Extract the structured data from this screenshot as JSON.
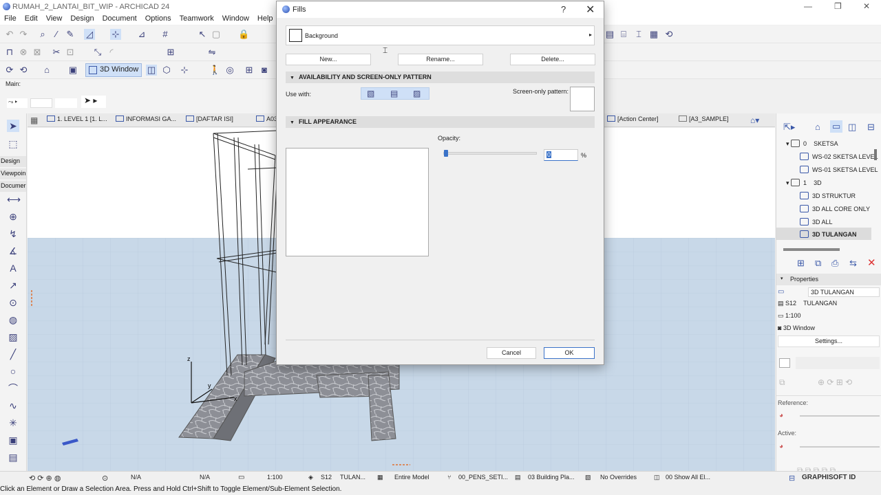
{
  "window": {
    "title": "RUMAH_2_LANTAI_BIT_WIP - ARCHICAD 24",
    "minimize": "—",
    "maximize": "❐",
    "close": "✕"
  },
  "menu": [
    "File",
    "Edit",
    "View",
    "Design",
    "Document",
    "Options",
    "Teamwork",
    "Window",
    "Help"
  ],
  "toolbar": {
    "view_3d_label": "3D Window",
    "info_box_label": "Main:"
  },
  "tabs": [
    {
      "label": "1. LEVEL 1 [1. L..."
    },
    {
      "label": "INFORMASI GA..."
    },
    {
      "label": "[DAFTAR ISI]"
    },
    {
      "label": "A03"
    },
    {
      "label": "[Action Center]"
    },
    {
      "label": "[A3_SAMPLE]"
    }
  ],
  "toolbox": {
    "palettes": [
      "Design",
      "Viewpoin",
      "Documer"
    ]
  },
  "navigator": {
    "items": [
      {
        "label": "0",
        "name": "SKETSA",
        "type": "folder"
      },
      {
        "label": "WS-02 SKETSA LEVEL",
        "type": "view"
      },
      {
        "label": "WS-01 SKETSA LEVEL",
        "type": "view"
      },
      {
        "label": "1",
        "name": "3D",
        "type": "folder"
      },
      {
        "label": "3D STRUKTUR",
        "type": "view"
      },
      {
        "label": "3D ALL CORE ONLY",
        "type": "view"
      },
      {
        "label": "3D ALL",
        "type": "view"
      },
      {
        "label": "3D TULANGAN",
        "type": "view",
        "selected": true
      }
    ]
  },
  "properties": {
    "header": "Properties",
    "name_value": "3D TULANGAN",
    "id_code": "S12",
    "id_name": "TULANGAN",
    "scale": "1:100",
    "source": "3D Window",
    "settings_label": "Settings...",
    "reference_label": "Reference:",
    "active_label": "Active:"
  },
  "statusbar": {
    "na1": "N/A",
    "na2": "N/A",
    "scale": "1:100",
    "layer_code": "S12",
    "layer_name": "TULAN...",
    "model": "Entire Model",
    "pens": "00_PENS_SETI...",
    "building_plan": "03 Building Pla...",
    "overrides": "No Overrides",
    "show_all": "00 Show All El...",
    "graphisoft_id": "GRAPHISOFT ID"
  },
  "hint": "Click an Element or Draw a Selection Area. Press and Hold Ctrl+Shift to Toggle Element/Sub-Element Selection.",
  "axes": {
    "z": "z",
    "y": "y",
    "x": "x"
  },
  "dialog": {
    "title": "Fills",
    "help": "?",
    "close": "✕",
    "fill_name": "Background",
    "new_label": "New...",
    "rename_label": "Rename...",
    "delete_label": "Delete...",
    "section1": "AVAILABILITY AND SCREEN-ONLY PATTERN",
    "use_with_label": "Use with:",
    "screen_only_label": "Screen-only pattern:",
    "section2": "FILL APPEARANCE",
    "opacity_label": "Opacity:",
    "opacity_value": "0",
    "opacity_fraction": 0.0,
    "opacity_unit": "%",
    "cancel_label": "Cancel",
    "ok_label": "OK"
  },
  "colors": {
    "accent": "#3a58a8",
    "ok_border": "#3a72c8",
    "floor": "#c5d6e6",
    "stone": "#8f8f95"
  }
}
